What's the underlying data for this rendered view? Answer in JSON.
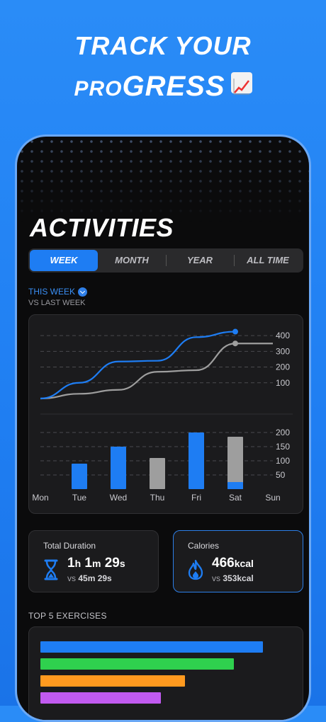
{
  "promo": {
    "line1": "TRACK YOUR",
    "line2_prefix": "PRO",
    "line2_suffix": "GRESS",
    "emoji": "chart-increasing-emoji"
  },
  "screen": {
    "title": "ACTIVITIES",
    "tabs": [
      {
        "label": "WEEK",
        "active": true
      },
      {
        "label": "MONTH",
        "active": false
      },
      {
        "label": "YEAR",
        "active": false
      },
      {
        "label": "ALL TIME",
        "active": false
      }
    ],
    "range_label": "THIS WEEK",
    "compare_label": "VS LAST WEEK"
  },
  "chart_data": [
    {
      "type": "line",
      "x": [
        "Mon",
        "Tue",
        "Wed",
        "Thu",
        "Fri",
        "Sat",
        "Sun"
      ],
      "series": [
        {
          "color": "#1e7df3",
          "values": [
            0,
            100,
            235,
            240,
            390,
            425,
            null
          ]
        },
        {
          "color": "#9e9e9e",
          "values": [
            0,
            30,
            55,
            170,
            180,
            350,
            350
          ]
        }
      ],
      "yticks": [
        100,
        200,
        300,
        400
      ],
      "ylim": [
        0,
        450
      ],
      "grid": true
    },
    {
      "type": "bar",
      "categories": [
        "Mon",
        "Tue",
        "Wed",
        "Thu",
        "Fri",
        "Sat",
        "Sun"
      ],
      "series": [
        {
          "color": "#1e7df3",
          "values": [
            0,
            90,
            150,
            0,
            200,
            25,
            0
          ]
        },
        {
          "color": "#9e9e9e",
          "values": [
            0,
            0,
            0,
            110,
            0,
            185,
            0
          ]
        }
      ],
      "yticks": [
        50,
        100,
        150,
        200
      ],
      "ylim": [
        0,
        210
      ],
      "grid": true
    }
  ],
  "stats": {
    "duration": {
      "label": "Total Duration",
      "h": "1",
      "h_unit": "h",
      "m": "1",
      "m_unit": "m",
      "s": "29",
      "s_unit": "s",
      "vs_prefix": "vs",
      "vs_value": "45m 29s"
    },
    "calories": {
      "label": "Calories",
      "value": "466",
      "unit": "kcal",
      "vs_prefix": "vs",
      "vs_value": "353kcal"
    }
  },
  "exercises": {
    "title": "TOP 5 EXERCISES",
    "bars": [
      {
        "color": "#1e7df3",
        "value": 1.0
      },
      {
        "color": "#2fd14e",
        "value": 0.87
      },
      {
        "color": "#ff9a1f",
        "value": 0.65
      },
      {
        "color": "#c15af0",
        "value": 0.54
      }
    ]
  },
  "colors": {
    "accent": "#1e7df3",
    "grey": "#9e9e9e"
  }
}
